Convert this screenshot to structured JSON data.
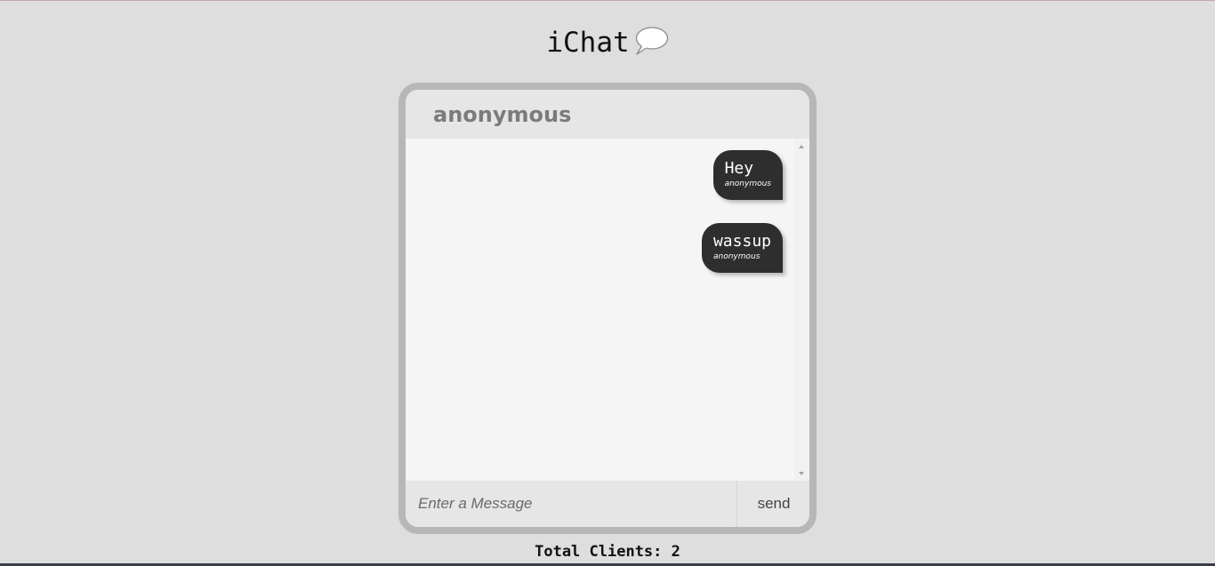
{
  "app": {
    "title": "iChat",
    "title_icon": "speech-bubble-icon"
  },
  "chat": {
    "username": "anonymous",
    "messages": [
      {
        "text": "Hey",
        "author": "anonymous"
      },
      {
        "text": "wassup",
        "author": "anonymous"
      }
    ],
    "composer": {
      "placeholder": "Enter a Message",
      "value": "",
      "send_label": "send"
    }
  },
  "status": {
    "total_clients_label": "Total Clients: 2"
  },
  "colors": {
    "page_background": "#dedede",
    "chat_border": "#b7b7b7",
    "bubble_background": "#2e2e2e",
    "username_text": "#7b7b7b"
  }
}
